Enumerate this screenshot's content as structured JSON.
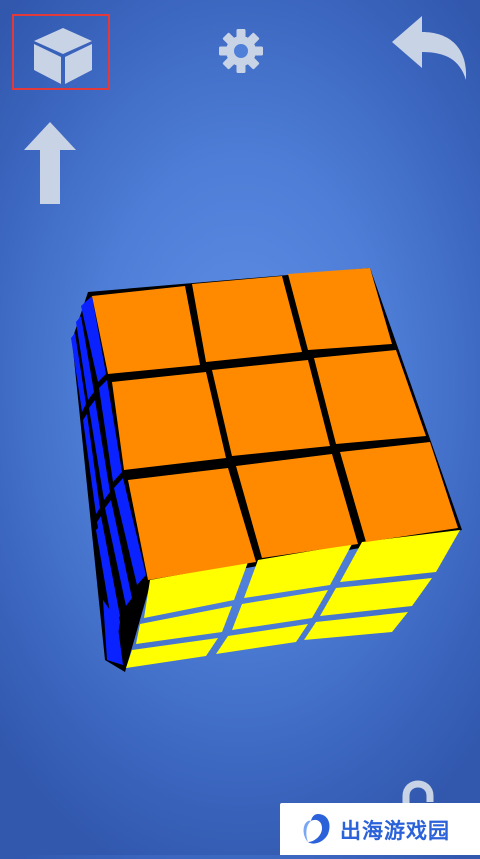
{
  "toolbar": {
    "view_button": {
      "icon": "cube-view-icon",
      "selected": true,
      "highlight_color": "#e23a3a"
    },
    "settings_button": {
      "icon": "gear-icon"
    },
    "undo_button": {
      "icon": "undo-arrow-icon"
    },
    "rotate_up_button": {
      "icon": "arrow-up-icon"
    },
    "lock_button": {
      "icon": "lock-icon"
    }
  },
  "cube": {
    "size": "3x3",
    "visible_faces": {
      "top": {
        "color": "#ff8a00",
        "name": "orange"
      },
      "left": {
        "color": "#0a22ff",
        "name": "blue"
      },
      "front": {
        "color": "#ffff00",
        "name": "yellow"
      }
    }
  },
  "watermark": {
    "text": "出海游戏园",
    "color": "#2b62d9"
  },
  "colors": {
    "background": "#4d7dd6",
    "icon": "#c9d3e6"
  }
}
